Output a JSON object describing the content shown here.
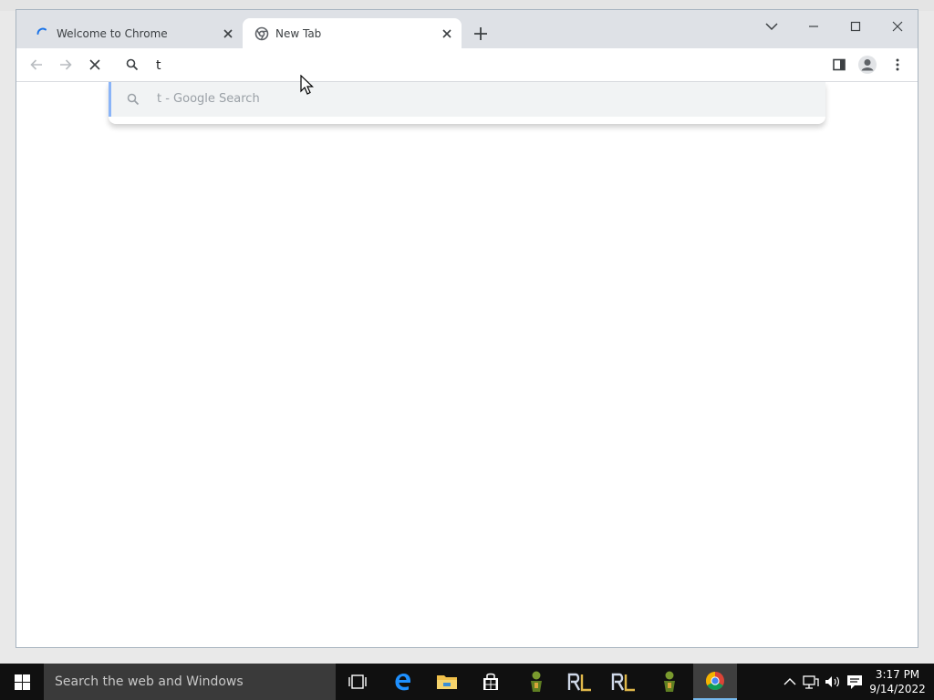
{
  "browser": {
    "tabs": [
      {
        "title": "Welcome to Chrome",
        "state": "loading",
        "favicon": "loading-spinner-icon"
      },
      {
        "title": "New Tab",
        "state": "active",
        "favicon": "chrome-icon"
      }
    ],
    "window_controls": [
      "tab-search",
      "minimize",
      "maximize",
      "close"
    ],
    "omnibox": {
      "value": "t"
    },
    "suggestions": [
      {
        "text": "t - Google Search",
        "icon": "search-icon"
      }
    ]
  },
  "taskbar": {
    "search_placeholder": "Search the web and Windows",
    "clock": {
      "time": "3:17 PM",
      "date": "9/14/2022"
    },
    "apps": [
      "task-view",
      "edge",
      "file-explorer",
      "store",
      "app-green-figure",
      "app-rl",
      "app-rl",
      "app-green-figure",
      "chrome"
    ]
  },
  "colors": {
    "titlebar": "#dee1e6",
    "accent": "#1a73e8",
    "taskbar": "#101010"
  }
}
